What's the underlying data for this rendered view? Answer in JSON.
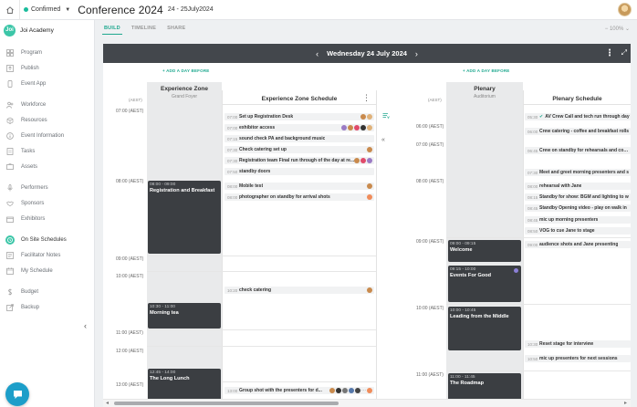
{
  "header": {
    "status": "Confirmed",
    "event_title": "Conference 2024",
    "event_dates": "24 - 25July2024"
  },
  "sidebar": {
    "org_initials": "Joi",
    "org_name": "Joi Academy",
    "items": [
      {
        "label": "Program",
        "icon": "grid-icon"
      },
      {
        "label": "Publish",
        "icon": "upload-icon"
      },
      {
        "label": "Event App",
        "icon": "phone-icon"
      },
      {
        "label": "Workforce",
        "icon": "people-icon"
      },
      {
        "label": "Resources",
        "icon": "box-icon"
      },
      {
        "label": "Event Information",
        "icon": "info-icon"
      },
      {
        "label": "Tasks",
        "icon": "checklist-icon"
      },
      {
        "label": "Assets",
        "icon": "asset-icon"
      },
      {
        "label": "Performers",
        "icon": "mic-icon"
      },
      {
        "label": "Sponsors",
        "icon": "handshake-icon"
      },
      {
        "label": "Exhibitors",
        "icon": "booth-icon"
      },
      {
        "label": "On Site Schedules",
        "icon": "clock-icon",
        "active": true
      },
      {
        "label": "Facilitator Notes",
        "icon": "note-icon"
      },
      {
        "label": "My Schedule",
        "icon": "calendar-icon"
      },
      {
        "label": "Budget",
        "icon": "money-icon"
      },
      {
        "label": "Backup",
        "icon": "export-icon"
      }
    ]
  },
  "tabs": [
    "BUILD",
    "TIMELINE",
    "SHARE"
  ],
  "zoom": "100%",
  "day": {
    "date": "Wednesday 24 July 2024"
  },
  "add_day_label": "+ ADD A DAY BEFORE",
  "aest": "(AEST)",
  "zones": [
    {
      "title": "Experience Zone",
      "subtitle": "Grand Foyer",
      "schedule_title": "Experience Zone Schedule",
      "times": [
        "07:00 (AEST)",
        "08:00 (AEST)",
        "09:00 (AEST)",
        "10:00 (AEST)",
        "11:00 (AEST)",
        "12:00 (AEST)",
        "13:00 (AEST)"
      ],
      "blocks": [
        {
          "time": "08:00 - 09:00",
          "name": "Registration and Breakfast"
        },
        {
          "time": "10:30 - 11:00",
          "name": "Morning tea"
        },
        {
          "time": "12:45 - 14:00",
          "name": "The Long Lunch"
        }
      ],
      "tasks": [
        {
          "time": "07:00",
          "name": "Set up Registration Desk"
        },
        {
          "time": "07:00",
          "name": "exhibitor access"
        },
        {
          "time": "07:15",
          "name": "sound check PA and background music"
        },
        {
          "time": "07:30",
          "name": "Check catering set up"
        },
        {
          "time": "07:30",
          "name": "Registration team Final run through of the day at re..."
        },
        {
          "time": "07:50",
          "name": "standby doors"
        },
        {
          "time": "08:00",
          "name": "Mobile test"
        },
        {
          "time": "08:00",
          "name": "photographer on standby for arrival shots"
        },
        {
          "time": "10:20",
          "name": "check catering"
        },
        {
          "time": "13:00",
          "name": "Group shot with the presenters for d..."
        }
      ]
    },
    {
      "title": "Plenary",
      "subtitle": "Auditorium",
      "schedule_title": "Plenary Schedule",
      "times": [
        "06:00 (AEST)",
        "07:00 (AEST)",
        "08:00 (AEST)",
        "09:00 (AEST)",
        "10:00 (AEST)",
        "11:00 (AEST)"
      ],
      "blocks": [
        {
          "time": "09:00 - 09:15",
          "name": "Welcome"
        },
        {
          "time": "09:15 - 10:00",
          "name": "Events For Good"
        },
        {
          "time": "10:00 - 10:45",
          "name": "Leading from the Middle"
        },
        {
          "time": "11:00 - 11:45",
          "name": "The Roadmap"
        }
      ],
      "tasks": [
        {
          "time": "05:30",
          "name": "AV Crew Call and tech run through day"
        },
        {
          "time": "06:00",
          "name": "Crew catering - coffee and breakfast rolls"
        },
        {
          "time": "06:45",
          "name": "Crew on standby for rehearsals and comm"
        },
        {
          "time": "07:30",
          "name": "Meet and greet morning presenters and s"
        },
        {
          "time": "08:00",
          "name": "rehearsal with Jane"
        },
        {
          "time": "08:15",
          "name": "Standby for show: BGM and lighting to w"
        },
        {
          "time": "08:45",
          "name": "Standby Opening video - play on walk in"
        },
        {
          "time": "08:45",
          "name": "mic up morning presenters"
        },
        {
          "time": "08:50",
          "name": "VOG to cue Jane to stage"
        },
        {
          "time": "09:00",
          "name": "audience shots and Jane presenting"
        },
        {
          "time": "10:30",
          "name": "Reset stage for interview"
        },
        {
          "time": "10:50",
          "name": "mic up presenters for next sessions"
        }
      ]
    }
  ],
  "colors": {
    "accent": "#1fa88f",
    "dark_block": "#3b3e42",
    "header_bar": "#43474c"
  }
}
